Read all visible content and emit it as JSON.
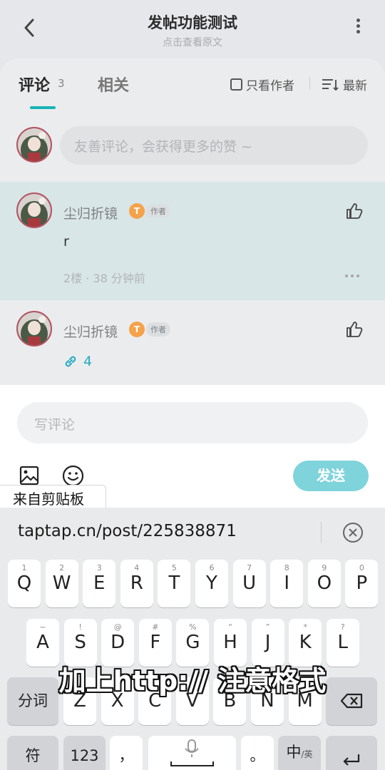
{
  "header": {
    "title": "发帖功能测试",
    "subtitle": "点击查看原文"
  },
  "tabs": {
    "comment_label": "评论",
    "comment_count": "3",
    "related_label": "相关"
  },
  "filters": {
    "author_only": "只看作者",
    "sort": "最新"
  },
  "composer": {
    "placeholder": "友善评论，会获得更多的赞 ~"
  },
  "comments": [
    {
      "user": "尘归折镜",
      "badge": "T",
      "tag": "作者",
      "text": "r",
      "meta": "2楼 · 38 分钟前"
    },
    {
      "user": "尘归折镜",
      "badge": "T",
      "tag": "作者",
      "link_count": "4"
    }
  ],
  "reply": {
    "placeholder": "写评论",
    "send_label": "发送",
    "clipboard_label": "来自剪贴板"
  },
  "keyboard": {
    "clipboard_text": "taptap.cn/post/225838871",
    "row1": [
      {
        "sub": "1",
        "key": "Q"
      },
      {
        "sub": "2",
        "key": "W"
      },
      {
        "sub": "3",
        "key": "E"
      },
      {
        "sub": "4",
        "key": "R"
      },
      {
        "sub": "5",
        "key": "T"
      },
      {
        "sub": "6",
        "key": "Y"
      },
      {
        "sub": "7",
        "key": "U"
      },
      {
        "sub": "8",
        "key": "I"
      },
      {
        "sub": "9",
        "key": "O"
      },
      {
        "sub": "0",
        "key": "P"
      }
    ],
    "row2": [
      {
        "sub": "~",
        "key": "A"
      },
      {
        "sub": "!",
        "key": "S"
      },
      {
        "sub": "@",
        "key": "D"
      },
      {
        "sub": "#",
        "key": "F"
      },
      {
        "sub": "%",
        "key": "G"
      },
      {
        "sub": "“",
        "key": "H"
      },
      {
        "sub": "”",
        "key": "J"
      },
      {
        "sub": "*",
        "key": "K"
      },
      {
        "sub": "?",
        "key": "L"
      }
    ],
    "row3": [
      {
        "sub": "(",
        "key": "Z"
      },
      {
        "sub": ")",
        "key": "X"
      },
      {
        "sub": "-",
        "key": "C"
      },
      {
        "sub": "_",
        "key": "V"
      },
      {
        "sub": ":",
        "key": "B"
      },
      {
        "sub": ";",
        "key": "N"
      },
      {
        "sub": "/",
        "key": "M"
      }
    ],
    "fenci_label": "分词",
    "symbol_label": "符",
    "num_label": "123",
    "comma_label": "，",
    "period_label": "。",
    "lang_label": "中",
    "lang_sub": "/英"
  },
  "overlay_caption": "加上http://  注意格式",
  "colors": {
    "accent": "#18b3b8",
    "send_button": "#7fd3db",
    "highlight_row": "#d8e6e7",
    "link": "#23a9c2",
    "badge": "#f5a24a"
  }
}
